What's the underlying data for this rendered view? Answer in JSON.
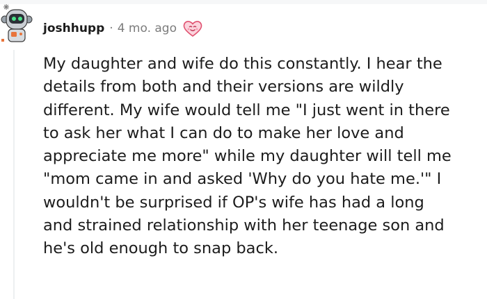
{
  "comment": {
    "username": "joshhupp",
    "separator": "·",
    "timestamp": "4 mo. ago",
    "avatar_icon": "robot-snoo-avatar-icon",
    "flair_icon": "heart-face-icon",
    "body_lines": [
      "My daughter and wife do this constantly. I hear the",
      "details from both and their versions are wildly",
      "different. My wife would tell me \"I just went in there",
      "to ask her what I can do to make her love and",
      "appreciate me more\" while my daughter will tell me",
      "\"mom came in and asked 'Why do you hate me.'\" I",
      "wouldn't be surprised if OP's wife has had a long",
      "and strained relationship with her teenage son and",
      "he's old enough to snap back."
    ]
  },
  "colors": {
    "text": "#1c1c1c",
    "meta": "#7c7c7c",
    "thread_line": "#edeff1",
    "flair_pink": "#f06e8a"
  }
}
